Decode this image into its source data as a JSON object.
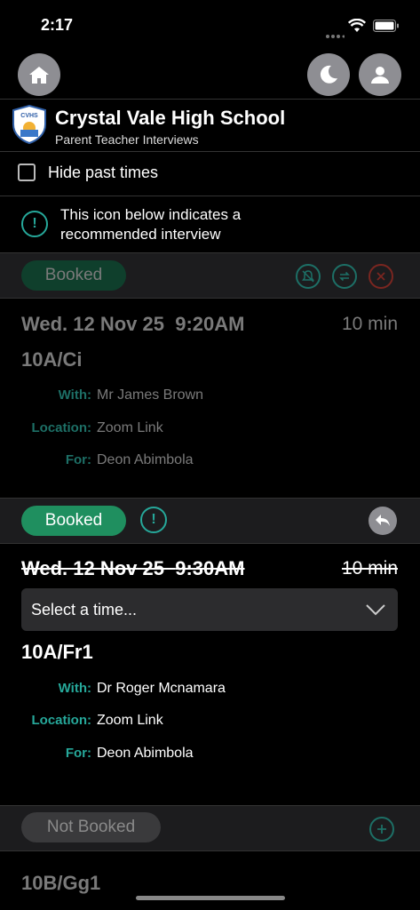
{
  "status": {
    "time": "2:17"
  },
  "header": {
    "school_name": "Crystal Vale High School",
    "subtitle": "Parent Teacher Interviews",
    "logo_text": "CVHS"
  },
  "filter": {
    "hide_past_label": "Hide past times"
  },
  "info": {
    "text_line1": "This icon below indicates a",
    "text_line2": "recommended interview"
  },
  "interviews": [
    {
      "status": "Booked",
      "date": "Wed. 12 Nov 25",
      "time": "9:20AM",
      "duration": "10 min",
      "class": "10A/Ci",
      "with_label": "With:",
      "with": "Mr James Brown",
      "location_label": "Location:",
      "location": "Zoom Link",
      "for_label": "For:",
      "for": "Deon Abimbola"
    },
    {
      "status": "Booked",
      "date": "Wed. 12 Nov 25",
      "time": "9:30AM",
      "duration": "10 min",
      "select_placeholder": "Select a time...",
      "class": "10A/Fr1",
      "with_label": "With:",
      "with": "Dr Roger Mcnamara",
      "location_label": "Location:",
      "location": "Zoom Link",
      "for_label": "For:",
      "for": "Deon Abimbola"
    },
    {
      "status": "Not Booked",
      "class": "10B/Gg1"
    }
  ],
  "colors": {
    "accent": "#26a89a",
    "booked_green": "#1f8f5f",
    "danger": "#c0392b",
    "muted": "#7a7a7a"
  }
}
